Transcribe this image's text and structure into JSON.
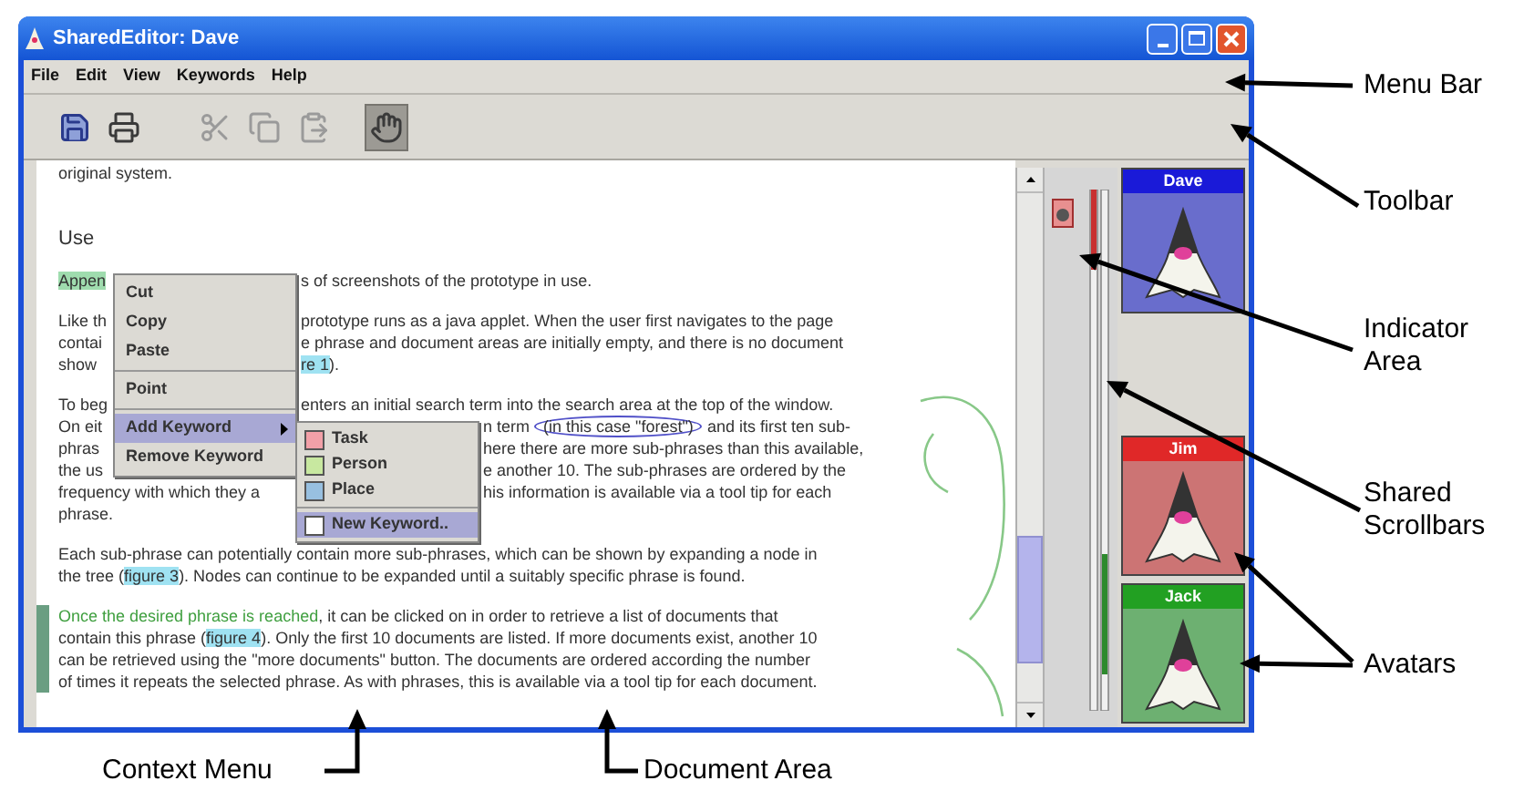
{
  "window": {
    "title": "SharedEditor: Dave"
  },
  "menu_bar": [
    "File",
    "Edit",
    "View",
    "Keywords",
    "Help"
  ],
  "toolbar": [
    {
      "kind": "save",
      "disabled": false,
      "pressed": false
    },
    {
      "kind": "print",
      "disabled": false,
      "pressed": false
    },
    {
      "kind": "cut",
      "disabled": true,
      "pressed": false
    },
    {
      "kind": "copy",
      "disabled": true,
      "pressed": false
    },
    {
      "kind": "paste",
      "disabled": true,
      "pressed": false
    },
    {
      "kind": "point",
      "disabled": false,
      "pressed": true
    }
  ],
  "document": {
    "paragraphs": [
      {
        "kind": "text",
        "change_bar": false,
        "lines": [
          {
            "left": [
              {
                "kind": "plain",
                "text": "original system."
              }
            ]
          }
        ]
      },
      {
        "kind": "heading",
        "change_bar": false,
        "lines": [
          {
            "left": [
              {
                "kind": "plain",
                "text": "Use"
              }
            ]
          }
        ]
      },
      {
        "kind": "text",
        "change_bar": false,
        "lines": [
          {
            "left": [
              {
                "kind": "highlight",
                "text": "Appen"
              }
            ],
            "right": [
              {
                "kind": "plain",
                "text": "s of screenshots of the prototype in use."
              }
            ]
          }
        ]
      },
      {
        "kind": "text",
        "change_bar": false,
        "lines": [
          {
            "left": [
              {
                "kind": "plain",
                "text": "Like th"
              }
            ],
            "right": [
              {
                "kind": "plain",
                "text": "prototype runs as a java applet. When the user first navigates to the page"
              }
            ]
          },
          {
            "left": [
              {
                "kind": "plain",
                "text": "contai"
              }
            ],
            "right": [
              {
                "kind": "plain",
                "text": "e phrase and document areas are initially empty, and there is no document"
              }
            ]
          },
          {
            "left": [
              {
                "kind": "plain",
                "text": "show"
              }
            ],
            "right": [
              {
                "kind": "link",
                "text": "re 1"
              },
              {
                "kind": "plain",
                "text": ")."
              }
            ]
          }
        ]
      },
      {
        "kind": "text",
        "change_bar": false,
        "lines": [
          {
            "left": [
              {
                "kind": "plain",
                "text": "To beg"
              }
            ],
            "right": [
              {
                "kind": "plain",
                "text": "enters an initial search term into the search area at the top of the window."
              }
            ]
          },
          {
            "left": [
              {
                "kind": "plain",
                "text": "On eit"
              }
            ],
            "right": [
              {
                "kind": "plain",
                "text": "n term "
              },
              {
                "kind": "circled",
                "text": "(in this case \"forest\")"
              },
              {
                "kind": "plain",
                "text": " and its first ten sub-"
              }
            ]
          },
          {
            "left": [
              {
                "kind": "plain",
                "text": "phras"
              }
            ],
            "right": [
              {
                "kind": "plain",
                "text": "here there are more sub-phrases than this available,"
              }
            ]
          },
          {
            "left": [
              {
                "kind": "plain",
                "text": "the us"
              }
            ],
            "right": [
              {
                "kind": "plain",
                "text": "e another 10. The sub-phrases are ordered by the"
              }
            ]
          },
          {
            "left": [
              {
                "kind": "plain",
                "text": "frequency with which they a"
              }
            ],
            "right": [
              {
                "kind": "plain",
                "text": "his information is available via a tool tip for each"
              }
            ]
          },
          {
            "left": [
              {
                "kind": "plain",
                "text": "phrase."
              }
            ]
          }
        ]
      },
      {
        "kind": "text",
        "change_bar": false,
        "lines": [
          {
            "left": [
              {
                "kind": "plain",
                "text": "Each sub-phrase can potentially contain more sub-phrases, which can be shown by expanding a node in"
              }
            ]
          },
          {
            "left": [
              {
                "kind": "plain",
                "text": "the tree ("
              },
              {
                "kind": "link",
                "text": "figure 3"
              },
              {
                "kind": "plain",
                "text": "). Nodes can continue to be expanded until a suitably specific phrase is found."
              }
            ]
          }
        ]
      },
      {
        "kind": "text",
        "change_bar": true,
        "lines": [
          {
            "left": [
              {
                "kind": "green",
                "text": "Once the desired phrase is reached"
              },
              {
                "kind": "plain",
                "text": ", it can be clicked on in order to retrieve a list of documents that"
              }
            ]
          },
          {
            "left": [
              {
                "kind": "plain",
                "text": "contain this phrase ("
              },
              {
                "kind": "link",
                "text": "figure 4"
              },
              {
                "kind": "plain",
                "text": "). Only the first 10 documents are listed. If more documents exist, another 10"
              }
            ]
          },
          {
            "left": [
              {
                "kind": "plain",
                "text": "can be retrieved using the \"more documents\" button. The documents are ordered according the number"
              }
            ]
          },
          {
            "left": [
              {
                "kind": "plain",
                "text": "of times it repeats the selected phrase. As with phrases, this is available via a tool tip for each document."
              }
            ]
          }
        ]
      }
    ]
  },
  "context_menu": {
    "items": [
      {
        "kind": "item",
        "label": "Cut",
        "selected": false
      },
      {
        "kind": "item",
        "label": "Copy",
        "selected": false
      },
      {
        "kind": "item",
        "label": "Paste",
        "selected": false
      },
      {
        "kind": "separator"
      },
      {
        "kind": "item",
        "label": "Point",
        "selected": false
      },
      {
        "kind": "separator"
      },
      {
        "kind": "submenu",
        "label": "Add Keyword",
        "selected": true
      },
      {
        "kind": "item",
        "label": "Remove Keyword",
        "selected": false
      }
    ]
  },
  "keyword_submenu": {
    "items": [
      {
        "kind": "swatch",
        "label": "Task",
        "color": "#f2a0a8",
        "selected": false
      },
      {
        "kind": "swatch",
        "label": "Person",
        "color": "#c8e8a0",
        "selected": false
      },
      {
        "kind": "swatch",
        "label": "Place",
        "color": "#98c0e0",
        "selected": false
      },
      {
        "kind": "separator"
      },
      {
        "kind": "swatch",
        "label": "New Keyword..",
        "color": "#ffffff",
        "selected": true
      }
    ]
  },
  "avatars": [
    {
      "name": "Dave",
      "color": "#1a1ad8"
    },
    {
      "name": "Jim",
      "color": "#e02828"
    },
    {
      "name": "Jack",
      "color": "#22a022"
    }
  ],
  "annotations": [
    {
      "label": "Menu Bar"
    },
    {
      "label": "Toolbar"
    },
    {
      "label": "Indicator Area"
    },
    {
      "label": "Shared Scrollbars"
    },
    {
      "label": "Avatars"
    },
    {
      "label": "Context Menu"
    },
    {
      "label": "Document Area"
    }
  ]
}
